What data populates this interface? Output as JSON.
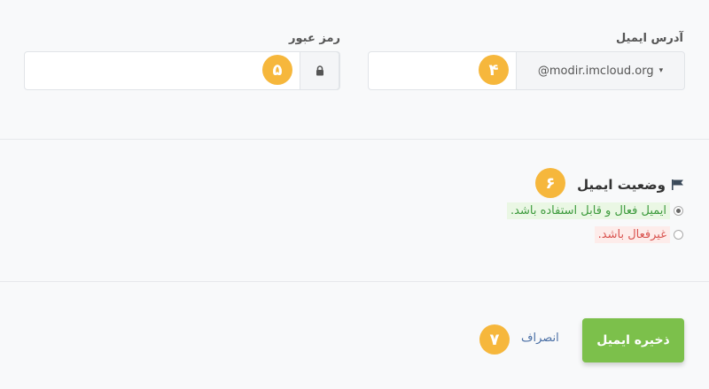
{
  "email": {
    "label": "آدرس ایمیل",
    "domain": "@modir.imcloud.org",
    "value": "",
    "badge": "۴"
  },
  "password": {
    "label": "رمز عبور",
    "value": "",
    "badge": "۵"
  },
  "status": {
    "title": "وضعیت ایمیل",
    "badge": "۶",
    "options": [
      {
        "label": "ایمیل فعال و قابل استفاده باشد.",
        "selected": true,
        "color": "#3c9a3c",
        "bg": "#eaf7e4"
      },
      {
        "label": "غیرفعال باشد.",
        "selected": false,
        "color": "#d9534f",
        "bg": "#fdecea"
      }
    ]
  },
  "actions": {
    "save_label": "ذخیره ایمیل",
    "cancel_label": "انصراف",
    "badge": "۷"
  },
  "colors": {
    "badge": "#f6b73c",
    "save_button": "#7cc04b",
    "cancel_link": "#4a6fa5"
  }
}
